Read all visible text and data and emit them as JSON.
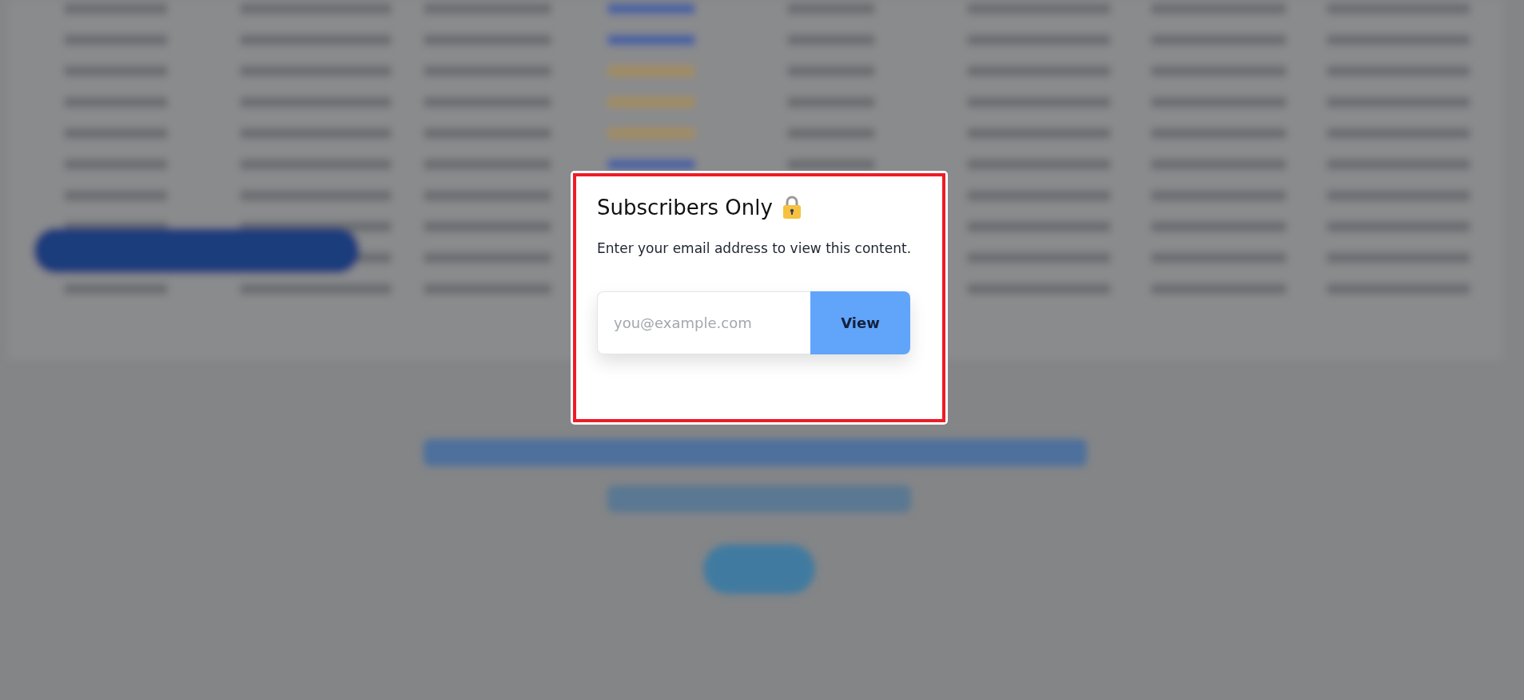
{
  "modal": {
    "title": "Subscribers Only",
    "message": "Enter your email address to view this content.",
    "email_field": {
      "placeholder": "you@example.com"
    },
    "button": "View"
  }
}
